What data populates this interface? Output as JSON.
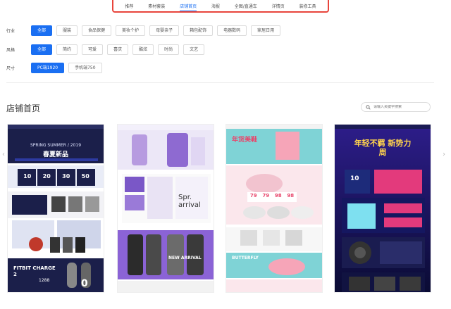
{
  "tabs": [
    "推荐",
    "素材套装",
    "店铺首页",
    "海报",
    "全图/直通车",
    "详情页",
    "装修工具"
  ],
  "active_tab": 2,
  "filters": {
    "industry": {
      "label": "行业",
      "options": [
        "全部",
        "服装",
        "食品保健",
        "美妆个护",
        "母婴亲子",
        "箱包配饰",
        "电器数码",
        "家居日用"
      ],
      "active": 0
    },
    "style": {
      "label": "风格",
      "options": [
        "全部",
        "简约",
        "可爱",
        "喜庆",
        "酷炫",
        "时尚",
        "文艺"
      ],
      "active": 0
    },
    "size": {
      "label": "尺寸",
      "options": [
        "PC端1920",
        "手机端750"
      ],
      "active": 0
    }
  },
  "section": {
    "title": "店铺首页",
    "search_placeholder": "请输入关键字搜索"
  },
  "cards": [
    {
      "name": "card-1",
      "headline": "SPRING SUMMER / 2019",
      "subtitle": "春夏新品",
      "nums": [
        "10",
        "20",
        "30",
        "50"
      ],
      "promo": "FITBIT CHARGE 2",
      "price": "1288",
      "digit": "0"
    },
    {
      "name": "card-2",
      "headline": "Spr. arrival",
      "subtitle": "NEW ARRIVAL",
      "promo": "",
      "price": ""
    },
    {
      "name": "card-3",
      "headline": "年货美鞋",
      "nums": [
        "79",
        "79",
        "98",
        "98"
      ],
      "promo": "BUTTERFLY",
      "price": ""
    },
    {
      "name": "card-4",
      "headline": "年轻不羁 新势力周",
      "subtitle": "",
      "nums": [
        "10"
      ],
      "promo": "",
      "price": ""
    }
  ],
  "colors": {
    "accent": "#1a6ff2",
    "tab_outline": "#e8453c"
  }
}
